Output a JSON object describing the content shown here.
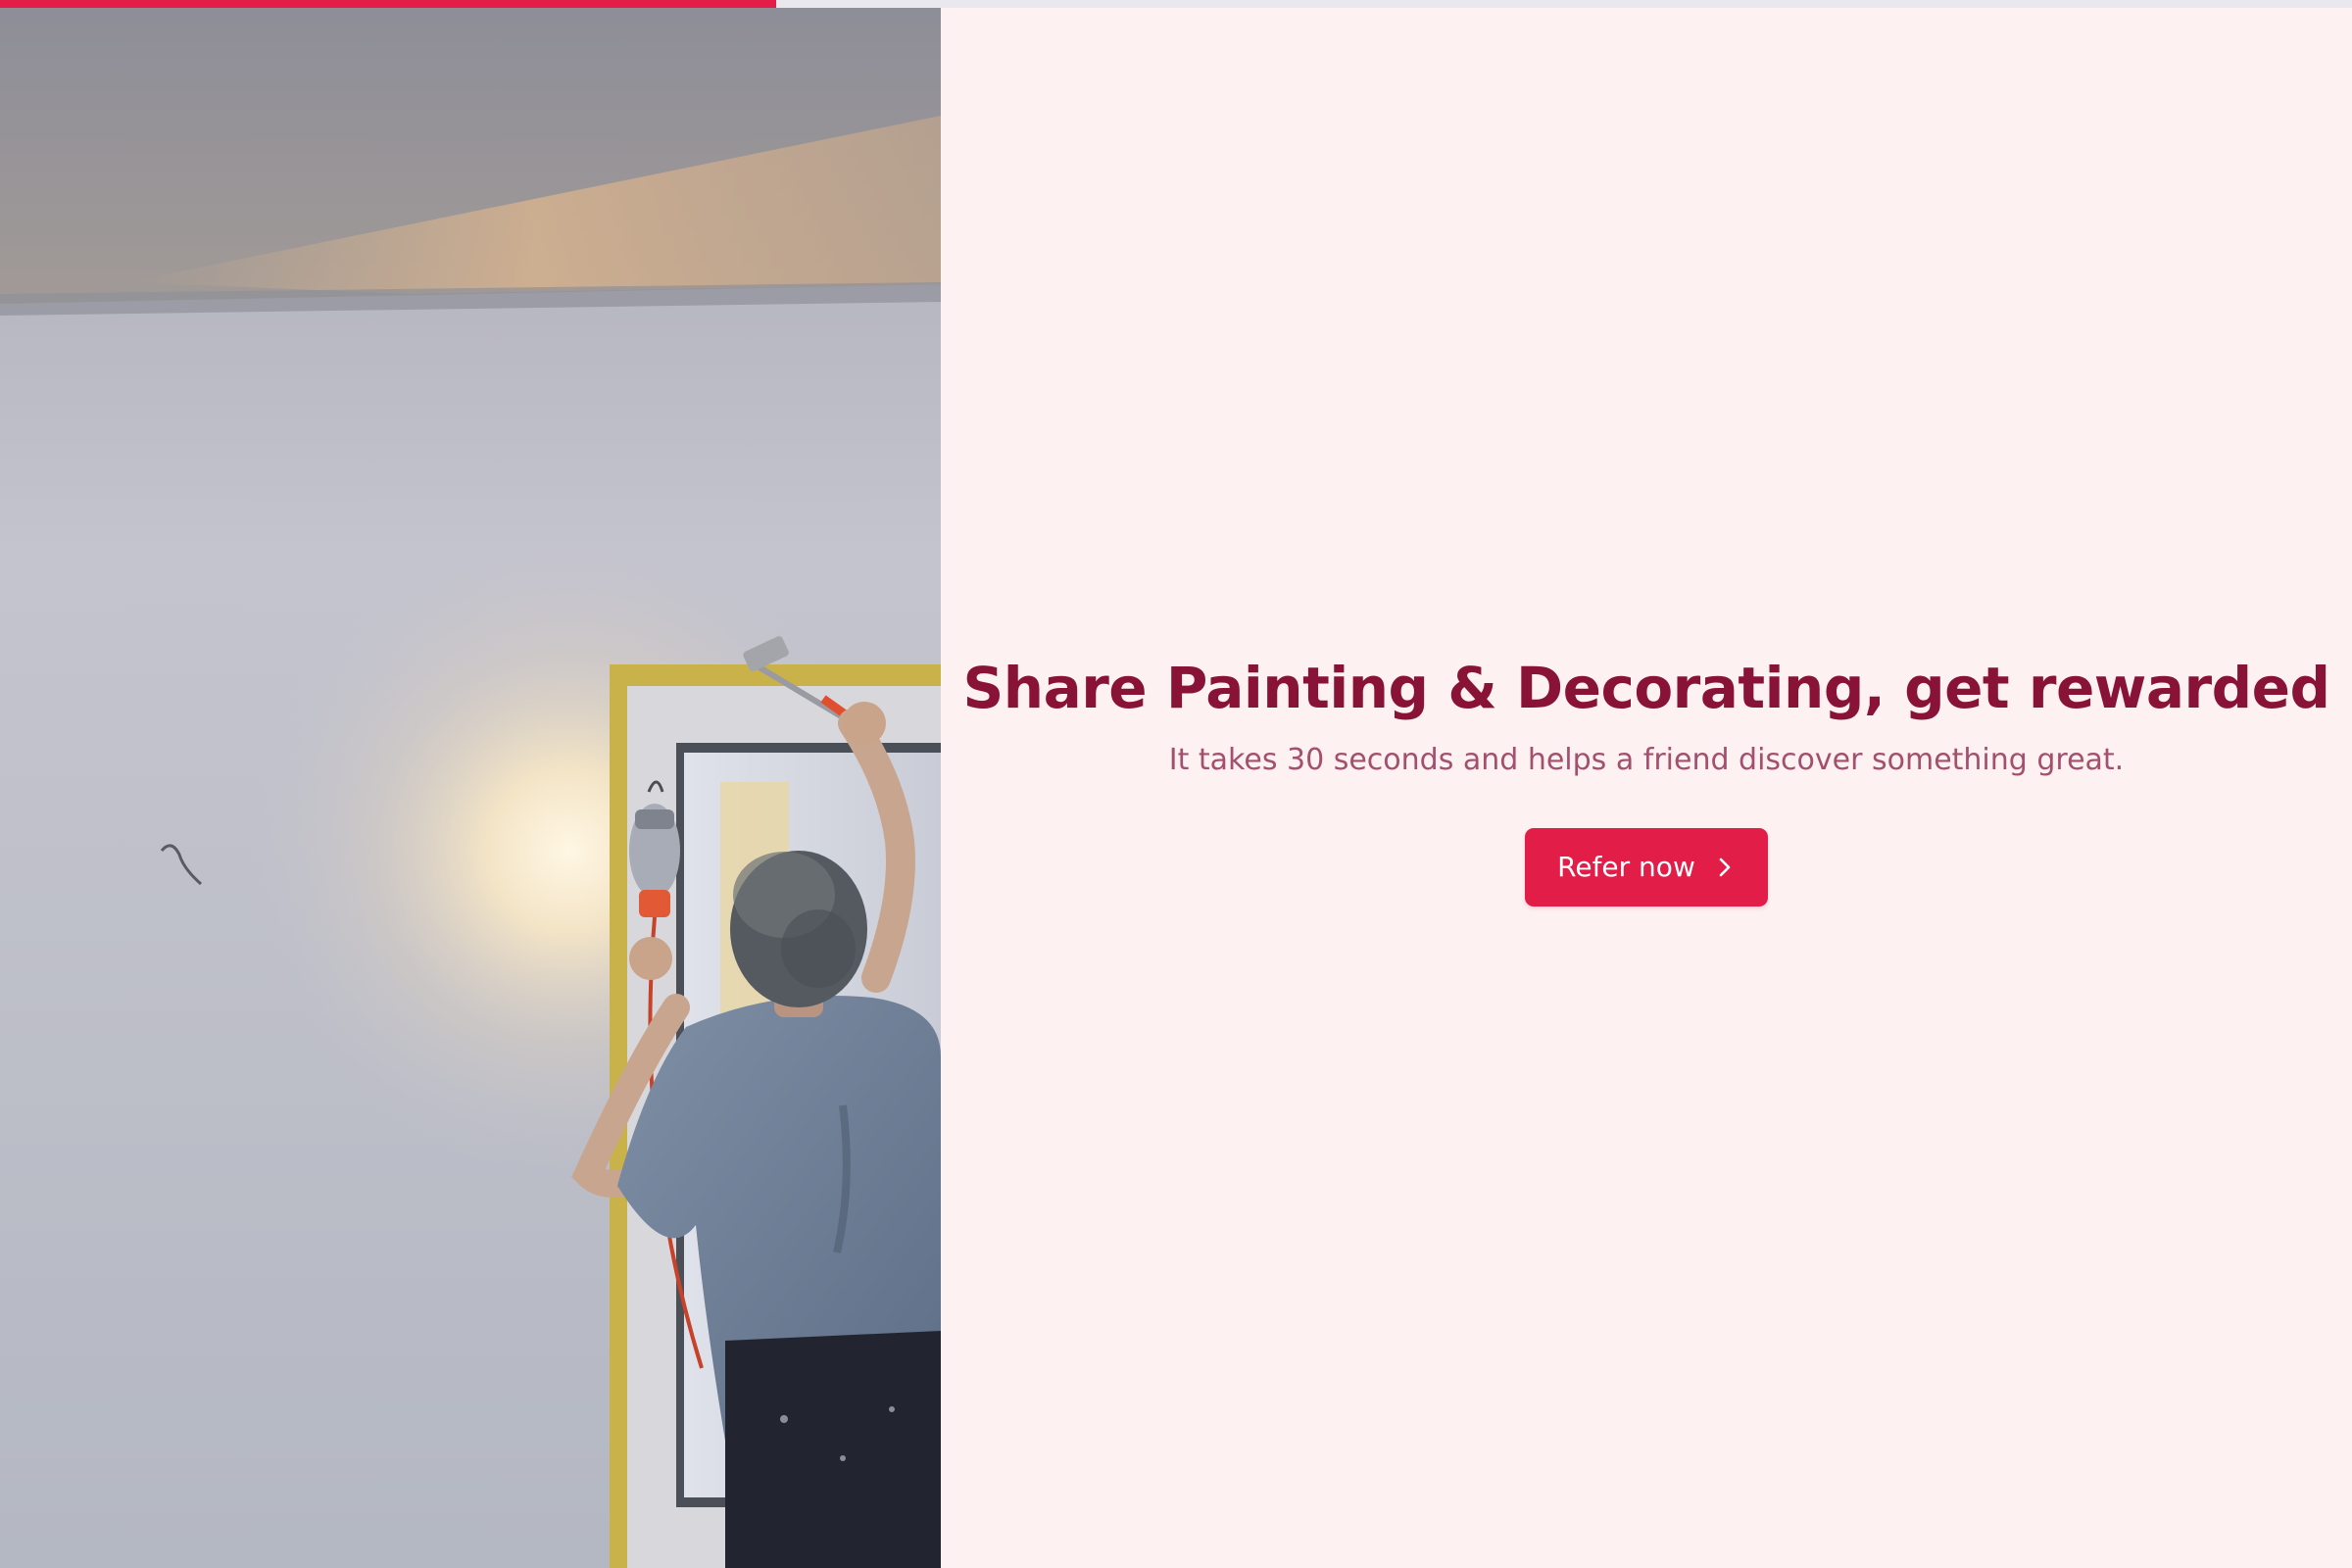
{
  "progress": {
    "fraction": 0.33,
    "color": "#e11d48",
    "track_color": "#e8e8ee"
  },
  "hero_image": {
    "subject": "painter-on-ladder-illustration"
  },
  "main": {
    "headline": "Share Painting & Decorating, get rewarded",
    "subtext": "It takes 30 seconds and helps a friend discover something great.",
    "cta_label": "Refer now",
    "cta_icon": "chevron-right-icon"
  },
  "colors": {
    "accent": "#e11d48",
    "headline": "#881337",
    "subtext": "#a3506f",
    "background": "#fdf1f1"
  }
}
